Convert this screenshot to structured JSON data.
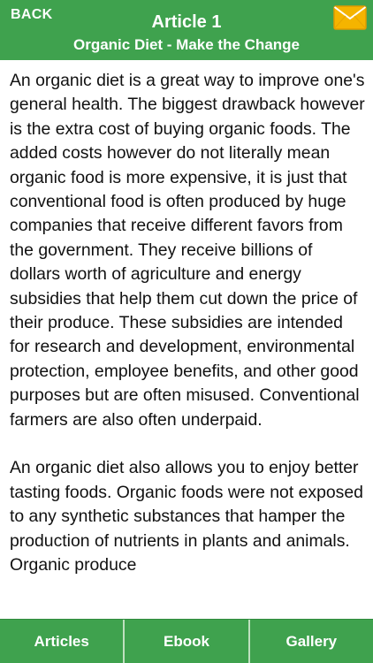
{
  "header": {
    "back_label": "BACK",
    "title": "Article 1",
    "subtitle": "Organic Diet - Make the Change",
    "mail_icon": "envelope-icon"
  },
  "article": {
    "paragraphs": [
      "An organic diet is a great way to improve one's general health. The biggest drawback however is the extra cost of buying organic foods. The added costs however do not literally mean organic food is more expensive, it is just that conventional food is often produced by huge companies that receive different favors from the government. They receive billions of dollars worth of agriculture and energy subsidies that help them cut down the price of their produce. These subsidies are intended for research and development, environmental protection, employee benefits, and other good purposes but are often misused. Conventional farmers are also often underpaid.",
      "An organic diet also allows you to enjoy better tasting foods. Organic foods were not exposed to any synthetic substances that hamper the production of nutrients in plants and animals. Organic produce"
    ]
  },
  "tabs": [
    {
      "label": "Articles"
    },
    {
      "label": "Ebook"
    },
    {
      "label": "Gallery"
    }
  ],
  "colors": {
    "accent": "#3fa24e",
    "tab_divider": "#bfe0bf",
    "mail_icon": "#f5b400"
  }
}
